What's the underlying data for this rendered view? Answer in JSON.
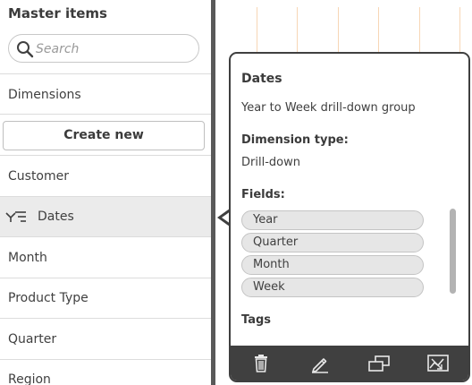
{
  "panel": {
    "title": "Master items",
    "search_placeholder": "Search",
    "section": "Dimensions",
    "create_label": "Create new",
    "items": [
      "Customer",
      "Dates",
      "Month",
      "Product Type",
      "Quarter",
      "Region"
    ],
    "selected_item": "Dates",
    "selected_icon": "drill-down-icon"
  },
  "popover": {
    "title": "Dates",
    "description": "Year to Week drill-down group",
    "type_heading": "Dimension type:",
    "type_value": "Drill-down",
    "fields_heading": "Fields:",
    "fields": [
      "Year",
      "Quarter",
      "Month",
      "Week"
    ],
    "tags_heading": "Tags",
    "actions": [
      "delete-icon",
      "edit-icon",
      "duplicate-icon",
      "add-to-sheet-icon"
    ]
  },
  "colors": {
    "divider": "#595959",
    "popover_border": "#3f3f3f",
    "toolbar_bg": "#404040",
    "selected_row": "#ebebeb",
    "chip_bg": "#e6e6e6",
    "canvas_gridline": "#f7d6b5"
  }
}
